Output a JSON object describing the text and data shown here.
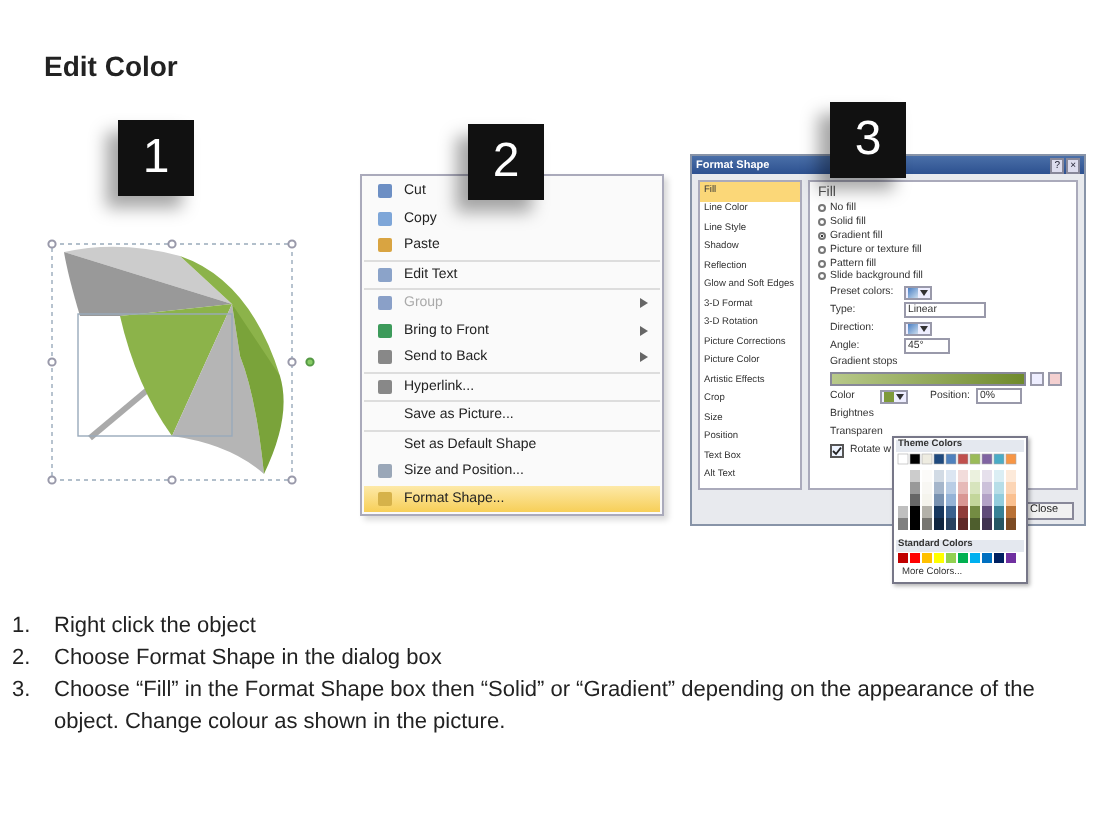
{
  "title": "Edit Color",
  "steps": [
    {
      "number": "1"
    },
    {
      "number": "2"
    },
    {
      "number": "3"
    }
  ],
  "context_menu": {
    "groups": [
      [
        {
          "label": "Cut",
          "has_icon": true,
          "disabled": false,
          "submenu": false,
          "selected": false
        },
        {
          "label": "Copy",
          "has_icon": true,
          "disabled": false,
          "submenu": false,
          "selected": false
        },
        {
          "label": "Paste",
          "has_icon": true,
          "disabled": false,
          "submenu": false,
          "selected": false
        }
      ],
      [
        {
          "label": "Edit Text",
          "has_icon": true,
          "disabled": false,
          "submenu": false,
          "selected": false
        }
      ],
      [
        {
          "label": "Group",
          "has_icon": true,
          "disabled": true,
          "submenu": true,
          "selected": false
        },
        {
          "label": "Bring to Front",
          "has_icon": true,
          "disabled": false,
          "submenu": true,
          "selected": false
        },
        {
          "label": "Send to Back",
          "has_icon": true,
          "disabled": false,
          "submenu": true,
          "selected": false
        }
      ],
      [
        {
          "label": "Hyperlink...",
          "has_icon": true,
          "disabled": false,
          "submenu": false,
          "selected": false
        }
      ],
      [
        {
          "label": "Save as Picture...",
          "has_icon": false,
          "disabled": false,
          "submenu": false,
          "selected": false
        }
      ],
      [
        {
          "label": "Set as Default Shape",
          "has_icon": false,
          "disabled": false,
          "submenu": false,
          "selected": false
        },
        {
          "label": "Size and Position...",
          "has_icon": true,
          "disabled": false,
          "submenu": false,
          "selected": false
        },
        {
          "label": "Format Shape...",
          "has_icon": true,
          "disabled": false,
          "submenu": false,
          "selected": true
        }
      ]
    ]
  },
  "dialog": {
    "title": "Format Shape",
    "help": "?",
    "close": "×",
    "nav": [
      {
        "label": "Fill",
        "selected": true
      },
      {
        "label": "Line Color",
        "selected": false
      },
      {
        "label": "Line Style",
        "selected": false
      },
      {
        "label": "Shadow",
        "selected": false
      },
      {
        "label": "Reflection",
        "selected": false
      },
      {
        "label": "Glow and Soft Edges",
        "selected": false
      },
      {
        "label": "3-D Format",
        "selected": false
      },
      {
        "label": "3-D Rotation",
        "selected": false
      },
      {
        "label": "Picture Corrections",
        "selected": false
      },
      {
        "label": "Picture Color",
        "selected": false
      },
      {
        "label": "Artistic Effects",
        "selected": false
      },
      {
        "label": "Crop",
        "selected": false
      },
      {
        "label": "Size",
        "selected": false
      },
      {
        "label": "Position",
        "selected": false
      },
      {
        "label": "Text Box",
        "selected": false
      },
      {
        "label": "Alt Text",
        "selected": false
      }
    ],
    "heading": "Fill",
    "fill_options": [
      {
        "label": "No fill",
        "selected": false
      },
      {
        "label": "Solid fill",
        "selected": false
      },
      {
        "label": "Gradient fill",
        "selected": true
      },
      {
        "label": "Picture or texture fill",
        "selected": false
      },
      {
        "label": "Pattern fill",
        "selected": false
      },
      {
        "label": "Slide background fill",
        "selected": false
      }
    ],
    "preset_colors_label": "Preset colors:",
    "type_label": "Type:",
    "type_value": "Linear",
    "direction_label": "Direction:",
    "angle_label": "Angle:",
    "angle_value": "45°",
    "gradient_stops_label": "Gradient stops",
    "color_label": "Color",
    "position_label": "Position:",
    "position_value": "0%",
    "brightness_label": "Brightnes",
    "transparency_label": "Transparen",
    "rotate_label": "Rotate w",
    "rotate_checked": true,
    "close_button": "Close",
    "popup": {
      "theme_heading": "Theme Colors",
      "standard_heading": "Standard Colors",
      "more": "More Colors..."
    }
  },
  "instructions": [
    {
      "number": "1.",
      "text": "Right click the object"
    },
    {
      "number": "2.",
      "text": "Choose Format Shape in the dialog box"
    },
    {
      "number": "3.",
      "text": "Choose “Fill” in the Format Shape box then “Solid” or “Gradient” depending on the appearance of the object. Change colour as shown in the picture."
    }
  ]
}
